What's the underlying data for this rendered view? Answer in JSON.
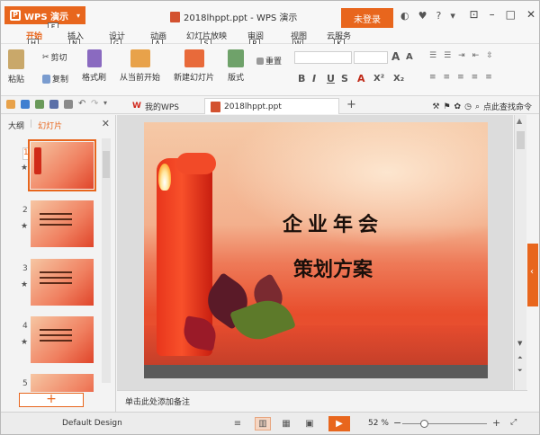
{
  "app": {
    "menu_label": "WPS 演示",
    "menu_key": "F",
    "window_title": "2018lhppt.ppt - WPS 演示",
    "login_label": "未登录"
  },
  "ribbon_tabs": [
    {
      "label": "开始",
      "key": "H"
    },
    {
      "label": "插入",
      "key": "N"
    },
    {
      "label": "设计",
      "key": "G"
    },
    {
      "label": "动画",
      "key": "A"
    },
    {
      "label": "幻灯片放映",
      "key": "S"
    },
    {
      "label": "审阅",
      "key": "R"
    },
    {
      "label": "视图",
      "key": "W"
    },
    {
      "label": "云服务",
      "key": "K"
    }
  ],
  "ribbon": {
    "cut": "剪切",
    "copy": "复制",
    "format_painter": "格式刷",
    "paste": "粘贴",
    "from_current": "从当前开始",
    "new_slide": "新建幻灯片",
    "layout": "版式",
    "reset": "重置",
    "bold": "B",
    "italic": "I",
    "underline": "U",
    "shadow": "S",
    "fontcolor": "A",
    "sup": "X²",
    "sub": "X₂",
    "grow": "A",
    "shrink": "A"
  },
  "doc_tabs": {
    "wps_home": "我的WPS",
    "doc": "2018lhppt.ppt",
    "help_search": "点此查找命令"
  },
  "left_panel": {
    "tab_outline": "大纲",
    "tab_slides": "幻灯片",
    "slides": [
      {
        "num": "1"
      },
      {
        "num": "2"
      },
      {
        "num": "3"
      },
      {
        "num": "4"
      },
      {
        "num": "5"
      }
    ]
  },
  "slide": {
    "title": "企业年会",
    "subtitle": "策划方案"
  },
  "notes": {
    "placeholder": "单击此处添加备注"
  },
  "status": {
    "design": "Default Design",
    "zoom": "52 %"
  },
  "colors": {
    "accent": "#e8661d"
  }
}
